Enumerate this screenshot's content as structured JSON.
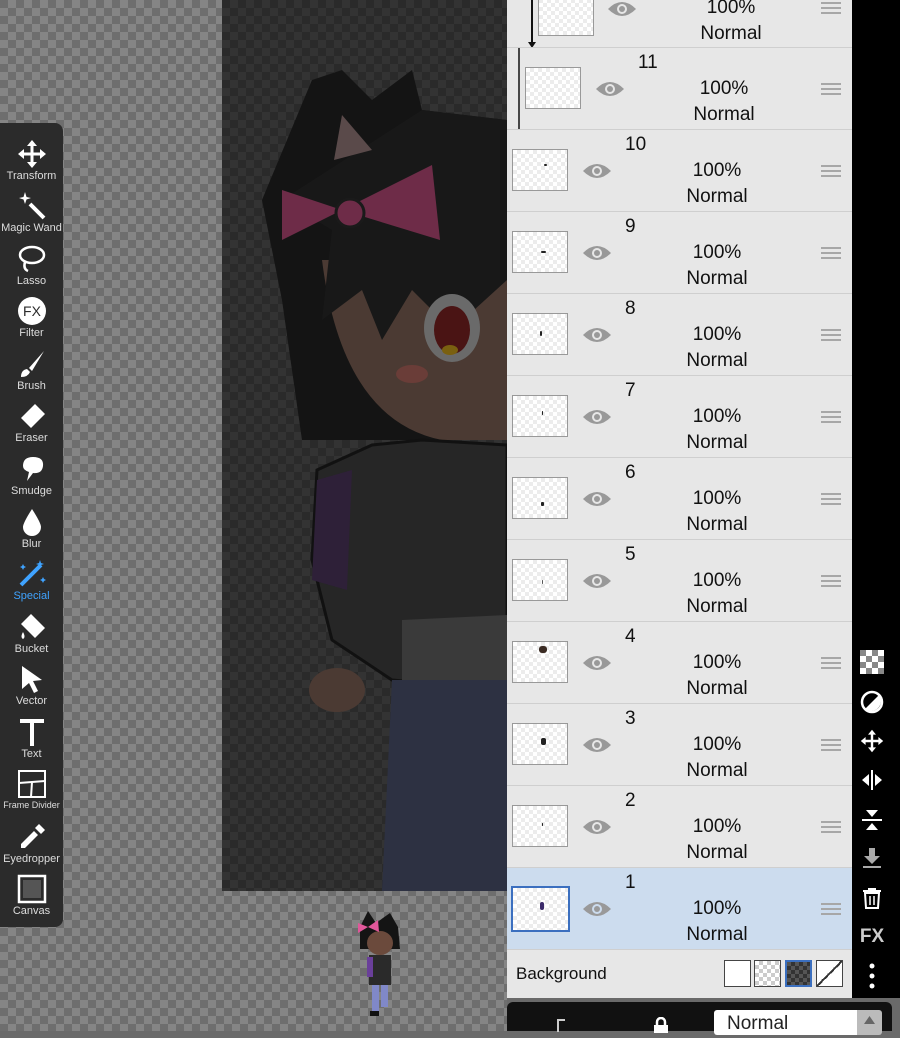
{
  "toolbar": {
    "tools": [
      {
        "label": "Transform",
        "icon": "move-arrows-icon"
      },
      {
        "label": "Magic Wand",
        "icon": "magic-wand-icon"
      },
      {
        "label": "Lasso",
        "icon": "lasso-icon"
      },
      {
        "label": "Filter",
        "icon": "fx-circle-icon"
      },
      {
        "label": "Brush",
        "icon": "brush-icon"
      },
      {
        "label": "Eraser",
        "icon": "eraser-icon"
      },
      {
        "label": "Smudge",
        "icon": "smudge-icon"
      },
      {
        "label": "Blur",
        "icon": "drop-icon"
      },
      {
        "label": "Special",
        "icon": "special-wand-icon"
      },
      {
        "label": "Bucket",
        "icon": "bucket-icon"
      },
      {
        "label": "Vector",
        "icon": "pointer-icon"
      },
      {
        "label": "Text",
        "icon": "text-t-icon"
      },
      {
        "label": "Frame Divider",
        "icon": "frame-divider-icon"
      },
      {
        "label": "Eyedropper",
        "icon": "eyedropper-icon"
      },
      {
        "label": "Canvas",
        "icon": "canvas-square-icon"
      }
    ],
    "active_tool": "Special",
    "active_color": "#3fa3ff"
  },
  "layers": {
    "items": [
      {
        "number": "",
        "opacity": "100%",
        "mode": "Normal",
        "clipped": true
      },
      {
        "number": "11",
        "opacity": "100%",
        "mode": "Normal",
        "clipped": true
      },
      {
        "number": "10",
        "opacity": "100%",
        "mode": "Normal"
      },
      {
        "number": "9",
        "opacity": "100%",
        "mode": "Normal"
      },
      {
        "number": "8",
        "opacity": "100%",
        "mode": "Normal"
      },
      {
        "number": "7",
        "opacity": "100%",
        "mode": "Normal"
      },
      {
        "number": "6",
        "opacity": "100%",
        "mode": "Normal"
      },
      {
        "number": "5",
        "opacity": "100%",
        "mode": "Normal"
      },
      {
        "number": "4",
        "opacity": "100%",
        "mode": "Normal"
      },
      {
        "number": "3",
        "opacity": "100%",
        "mode": "Normal"
      },
      {
        "number": "2",
        "opacity": "100%",
        "mode": "Normal"
      },
      {
        "number": "1",
        "opacity": "100%",
        "mode": "Normal",
        "selected": true
      }
    ],
    "background_label": "Background",
    "selected_color": "#ccdcee"
  },
  "right_icons": [
    "checker-icon",
    "half-circle-icon",
    "move-icon",
    "flip-horizontal-icon",
    "flip-vertical-icon",
    "merge-down-icon",
    "trash-icon",
    "fx-text-icon",
    "more-vertical-icon"
  ],
  "right_fx_label": "FX",
  "bottom": {
    "blend_mode": "Normal"
  }
}
